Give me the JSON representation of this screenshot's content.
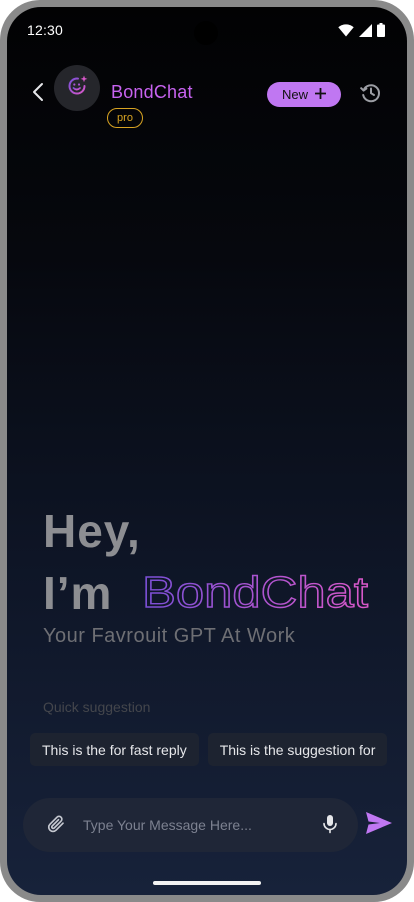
{
  "status_bar": {
    "time": "12:30",
    "icons": [
      "wifi-icon",
      "signal-icon",
      "battery-icon"
    ]
  },
  "header": {
    "back_icon": "chevron-left-icon",
    "avatar_icon": "smile-sparkle-icon",
    "title": "BondChat",
    "badge": "pro",
    "new_button_label": "New",
    "new_button_icon": "plus-icon",
    "history_icon": "history-icon"
  },
  "hero": {
    "greeting": "Hey,",
    "intro": "I’m",
    "brand": "BondChat",
    "subtitle": "Your Favrouit GPT At Work"
  },
  "suggestions": {
    "label": "Quick suggestion",
    "items": [
      "This is the for fast reply",
      "This is the suggestion for"
    ]
  },
  "composer": {
    "placeholder": "Type Your Message Here...",
    "value": "",
    "attach_icon": "paperclip-icon",
    "mic_icon": "microphone-icon",
    "send_icon": "send-icon"
  },
  "colors": {
    "accent": "#c077f2",
    "title": "#c863f0",
    "brand_outline_start": "#7a4fd6",
    "brand_outline_end": "#d958c9",
    "pro_badge": "#d9a422",
    "chip_background": "#1d2330",
    "composer_background": "#1f2637"
  }
}
